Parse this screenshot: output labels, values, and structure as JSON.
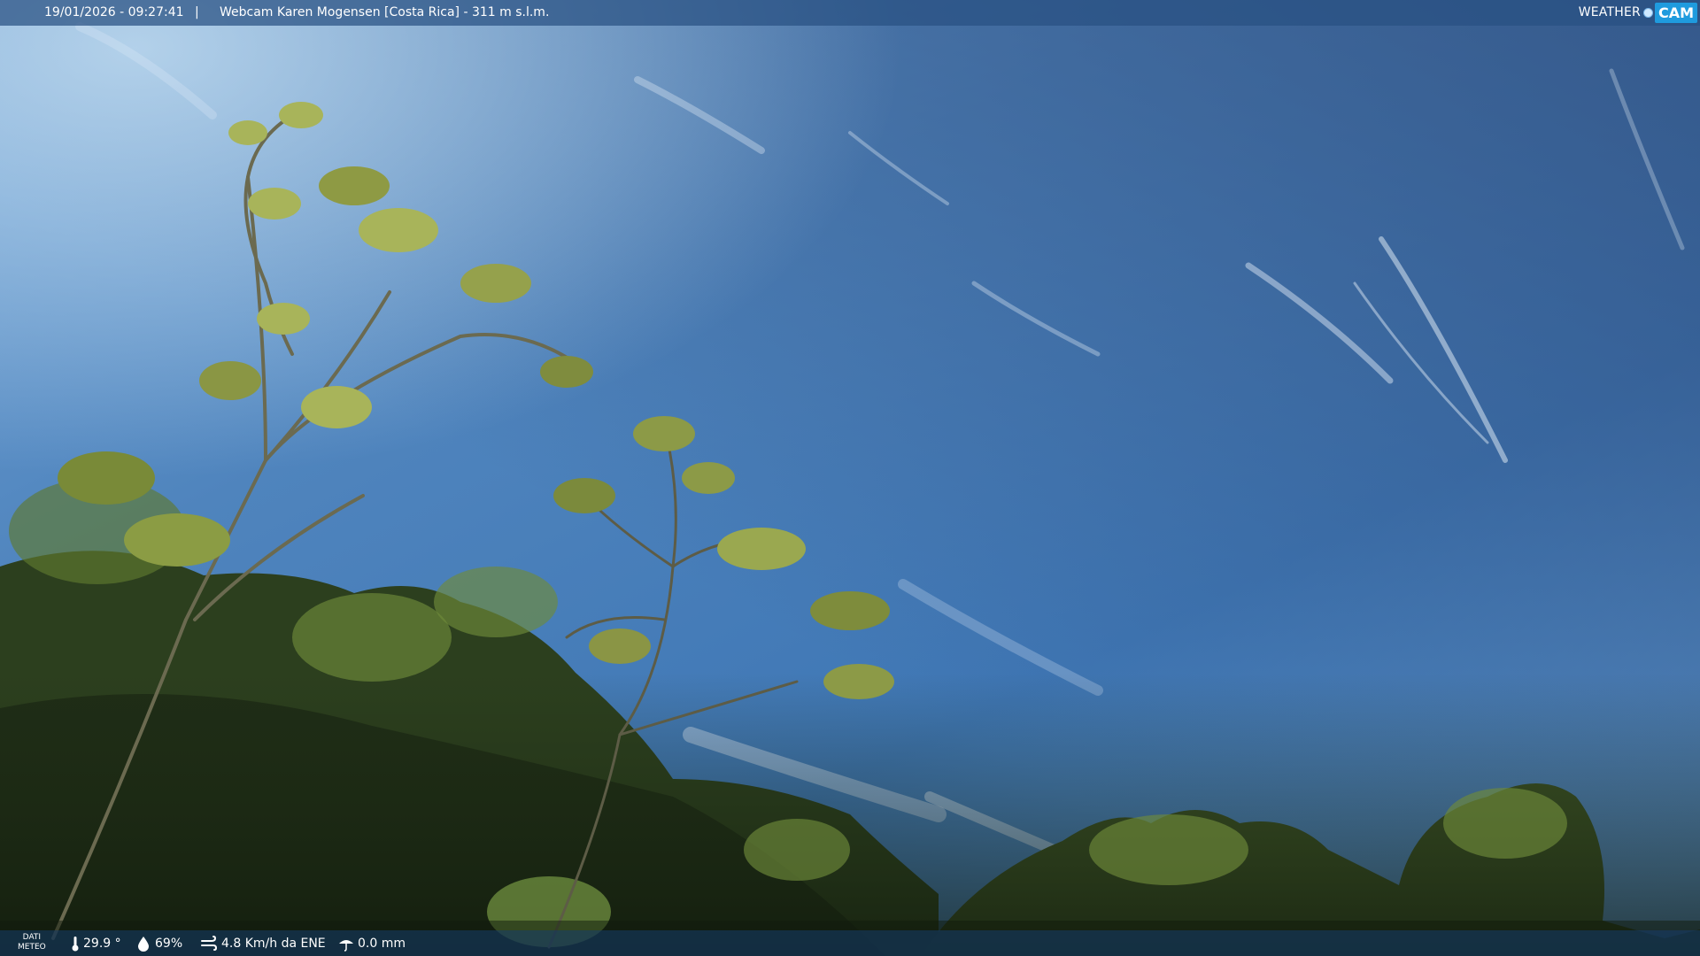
{
  "overlay": {
    "datetime": "19/01/2026 - 09:27:41",
    "separator": "|",
    "camera_name": "Webcam Karen Mogensen [Costa Rica] - 311 m s.l.m.",
    "logo": {
      "left": "WEATHER",
      "right": "CAM",
      "brand_color": "#1f9bde"
    }
  },
  "weather_data": {
    "label_line1": "DATI",
    "label_line2": "METEO",
    "temperature": "29.9 °",
    "humidity": "69%",
    "wind": "4.8 Km/h da ENE",
    "rain": "0.0 mm",
    "icons": [
      "thermometer-icon",
      "humidity-drop-icon",
      "wind-icon",
      "rain-icon"
    ]
  },
  "colors": {
    "sky_top": "#4a6fa5",
    "sky_horizon": "#7fb3e0",
    "foliage_dark": "#23311a",
    "foliage_light": "#8ea84a"
  }
}
